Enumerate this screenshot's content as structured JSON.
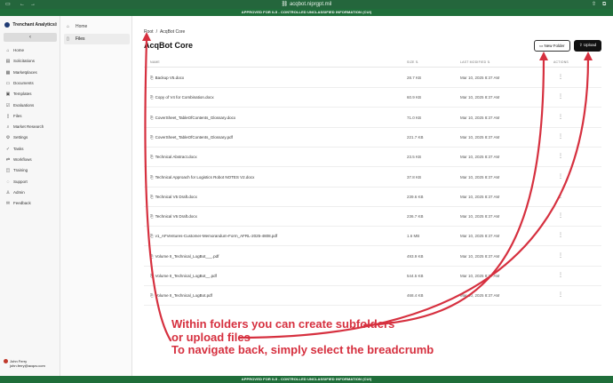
{
  "browser": {
    "url": "acqbot.niprgpt.mil",
    "sidebar_icon": "sidebar-icon",
    "back_icon": "back-icon",
    "forward_icon": "forward-icon",
    "share_icon": "share-icon"
  },
  "banner": {
    "top": "APPROVED FOR IL5 - CONTROLLED UNCLASSIFIED INFORMATION (CUI)",
    "bottom": "APPROVED FOR IL5 - CONTROLLED UNCLASSIFIED INFORMATION (CUI)"
  },
  "org": {
    "name": "Trenchant Analytics",
    "switch_icon": "⇕"
  },
  "collapse_icon": "‹",
  "nav": [
    {
      "label": "Home",
      "icon": "⌂"
    },
    {
      "label": "Solicitations",
      "icon": "▤"
    },
    {
      "label": "Marketplaces",
      "icon": "▦"
    },
    {
      "label": "Documents",
      "icon": "▭"
    },
    {
      "label": "Templates",
      "icon": "▣"
    },
    {
      "label": "Evaluations",
      "icon": "☑"
    },
    {
      "label": "Files",
      "icon": "▯"
    },
    {
      "label": "Market Research",
      "icon": "⌕"
    },
    {
      "label": "Settings",
      "icon": "⚙"
    },
    {
      "label": "Tasks",
      "icon": "✓"
    },
    {
      "label": "Workflows",
      "icon": "⇄"
    },
    {
      "label": "Training",
      "icon": "◫"
    },
    {
      "label": "Support",
      "icon": "◌"
    },
    {
      "label": "Admin",
      "icon": "♙"
    },
    {
      "label": "Feedback",
      "icon": "✉"
    }
  ],
  "user": {
    "name": "John Ferry",
    "email": "john.ferry@acqov.com"
  },
  "subnav": [
    {
      "label": "Home",
      "icon": "⌂"
    },
    {
      "label": "Files",
      "icon": "▯"
    }
  ],
  "breadcrumb": {
    "root": "Root",
    "sep": "/",
    "current": "AcqBot Core"
  },
  "page_title": "AcqBot Core",
  "buttons": {
    "new_folder": "New Folder",
    "new_folder_icon": "▭",
    "upload": "Upload",
    "upload_icon": "⇪"
  },
  "table": {
    "headers": {
      "name": "NAME",
      "size": "SIZE ⇅",
      "modified": "LAST MODIFIED ⇅",
      "actions": "ACTIONS"
    },
    "file_icon": "⎘",
    "actions_icon": "⋮",
    "rows": [
      {
        "name": "Backup V5.docx",
        "size": "28.7 KB",
        "modified": "Mar 10, 2025 8:37 AM"
      },
      {
        "name": "Copy of V4 for Combination.docx",
        "size": "60.9 KB",
        "modified": "Mar 10, 2025 8:37 AM"
      },
      {
        "name": "CoverSheet_TableOfContents_Glossary.docx",
        "size": "71.0 KB",
        "modified": "Mar 10, 2025 8:37 AM"
      },
      {
        "name": "CoverSheet_TableOfContents_Glossary.pdf",
        "size": "221.7 KB",
        "modified": "Mar 10, 2025 8:37 AM"
      },
      {
        "name": "Technical Abstract.docx",
        "size": "23.5 KB",
        "modified": "Mar 10, 2025 8:37 AM"
      },
      {
        "name": "Technical Approach for Logistics Robot NOTES V2.docx",
        "size": "37.8 KB",
        "modified": "Mar 10, 2025 8:37 AM"
      },
      {
        "name": "Technical V5 Draft.docx",
        "size": "239.6 KB",
        "modified": "Mar 10, 2025 8:37 AM"
      },
      {
        "name": "Technical V6 Draft.docx",
        "size": "236.7 KB",
        "modified": "Mar 10, 2025 8:37 AM"
      },
      {
        "name": "v1_AFVentures-Customer-Memorandum-Form_AFRL-2025-4808.pdf",
        "size": "1.6 MB",
        "modified": "Mar 10, 2025 8:37 AM"
      },
      {
        "name": "Volume II_Technical_LogBot___.pdf",
        "size": "493.9 KB",
        "modified": "Mar 10, 2025 8:37 AM"
      },
      {
        "name": "Volume II_Technical_LogBot__.pdf",
        "size": "544.5 KB",
        "modified": "Mar 10, 2025 8:37 AM"
      },
      {
        "name": "Volume II_Technical_LogBot.pdf",
        "size": "468.4 KB",
        "modified": "Mar 10, 2025 8:37 AM"
      }
    ]
  },
  "annotation": {
    "line1": "Within folders you can create subfolders",
    "line2": "or upload files",
    "line3": "To navigate back, simply select the breadcrumb",
    "color": "#d6303f"
  }
}
